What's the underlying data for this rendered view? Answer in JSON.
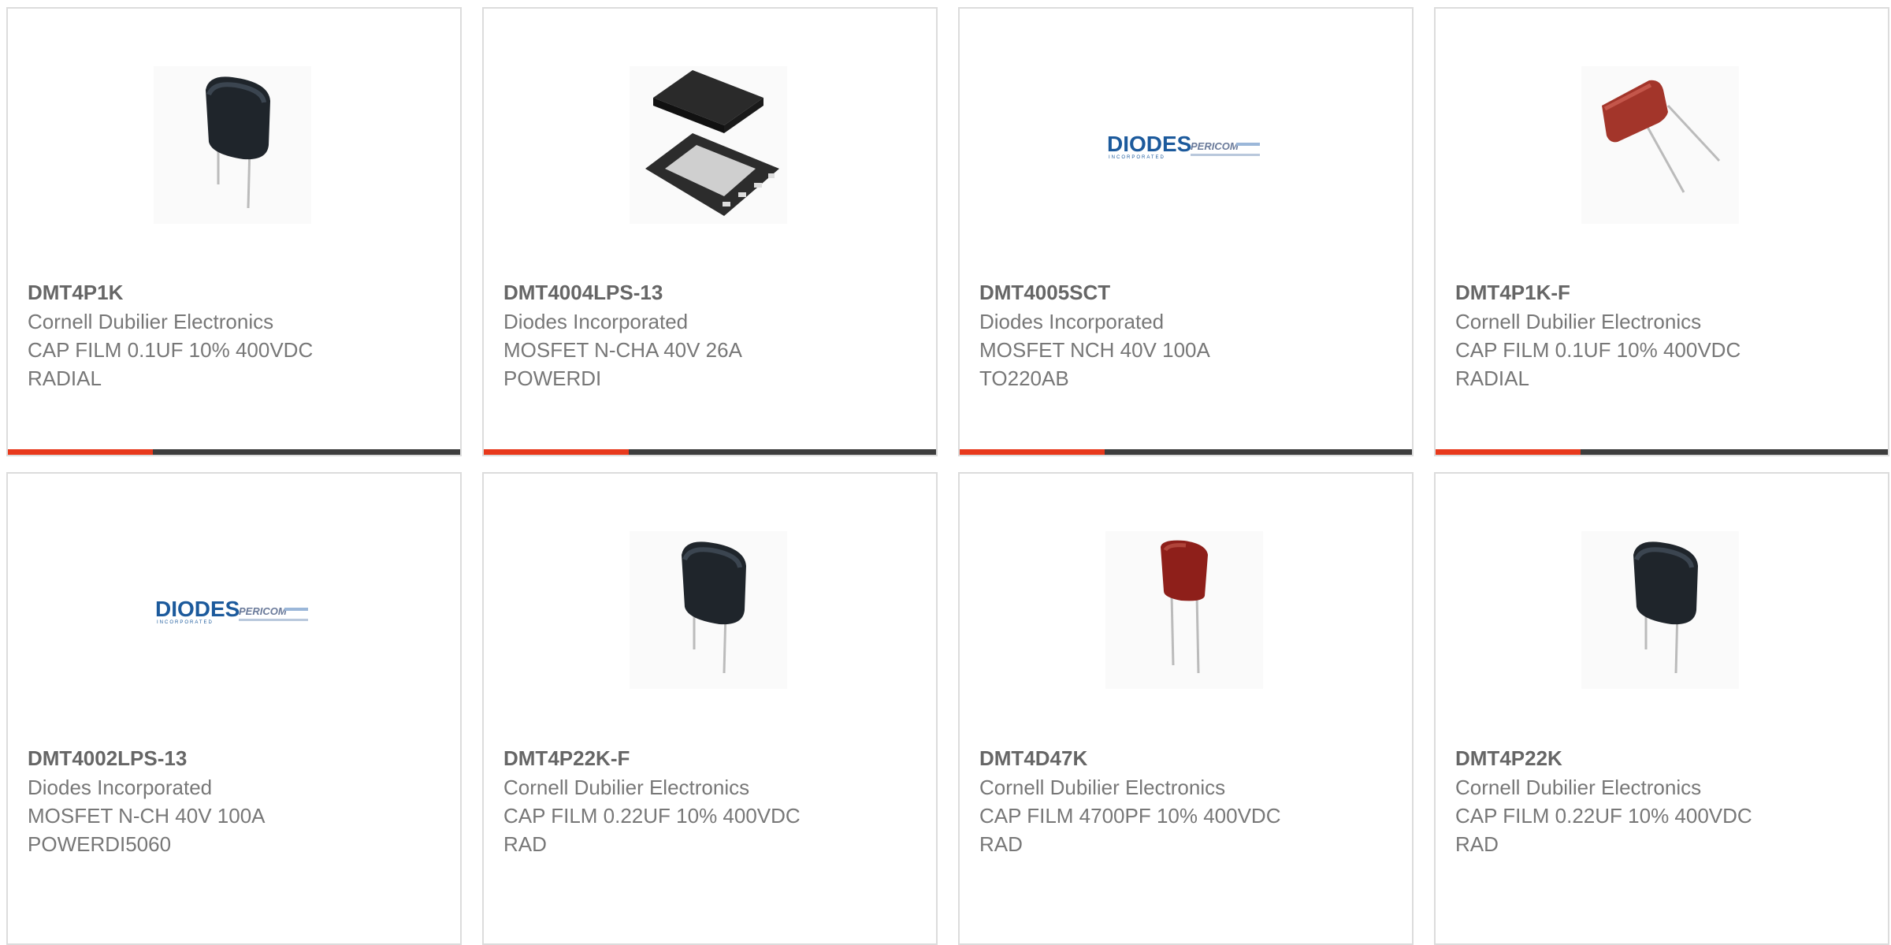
{
  "colors": {
    "accent": "#e8391c",
    "bar": "#3d3d3d",
    "border": "#dcdcdc",
    "title": "#666666",
    "text": "#777777"
  },
  "progress_fraction": 0.32,
  "products": [
    {
      "part_number": "DMT4P1K",
      "manufacturer": "Cornell Dubilier Electronics",
      "desc1": "CAP FILM 0.1UF 10% 400VDC",
      "desc2": "RADIAL",
      "image": "black-film-capacitor"
    },
    {
      "part_number": "DMT4004LPS-13",
      "manufacturer": "Diodes Incorporated",
      "desc1": "MOSFET N-CHA 40V 26A",
      "desc2": "POWERDI",
      "image": "powerdi-package"
    },
    {
      "part_number": "DMT4005SCT",
      "manufacturer": "Diodes Incorporated",
      "desc1": "MOSFET NCH 40V 100A",
      "desc2": "TO220AB",
      "image": "diodes-logo"
    },
    {
      "part_number": "DMT4P1K-F",
      "manufacturer": "Cornell Dubilier Electronics",
      "desc1": "CAP FILM 0.1UF 10% 400VDC",
      "desc2": "RADIAL",
      "image": "red-film-capacitor"
    },
    {
      "part_number": "DMT4002LPS-13",
      "manufacturer": "Diodes Incorporated",
      "desc1": "MOSFET N-CH 40V 100A",
      "desc2": "POWERDI5060",
      "image": "diodes-logo"
    },
    {
      "part_number": "DMT4P22K-F",
      "manufacturer": "Cornell Dubilier Electronics",
      "desc1": "CAP FILM 0.22UF 10% 400VDC",
      "desc2": "RAD",
      "image": "black-film-capacitor"
    },
    {
      "part_number": "DMT4D47K",
      "manufacturer": "Cornell Dubilier Electronics",
      "desc1": "CAP FILM 4700PF 10% 400VDC",
      "desc2": "RAD",
      "image": "red-small-capacitor"
    },
    {
      "part_number": "DMT4P22K",
      "manufacturer": "Cornell Dubilier Electronics",
      "desc1": "CAP FILM 0.22UF 10% 400VDC",
      "desc2": "RAD",
      "image": "black-film-capacitor"
    }
  ],
  "logo": {
    "brand": "DIODES",
    "sub": "INCORPORATED",
    "partner": "PERICOM"
  }
}
